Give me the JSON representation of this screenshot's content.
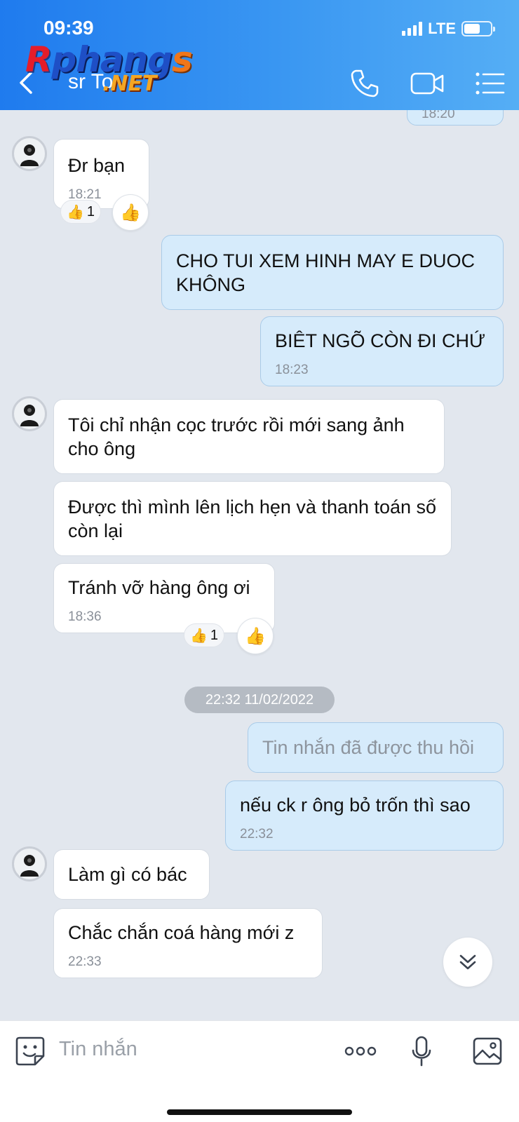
{
  "status_bar": {
    "time": "09:39",
    "network": "LTE"
  },
  "header": {
    "title": "sr To",
    "back_icon": "chevron-left-icon",
    "call_icon": "phone-icon",
    "video_icon": "video-camera-icon",
    "menu_icon": "list-menu-icon"
  },
  "watermark": {
    "brand": "Rphangs",
    "suffix": ".NET"
  },
  "messages": [
    {
      "time": "18:20"
    },
    {
      "text": "Đr bạn",
      "time": "18:21",
      "reaction_count": "1"
    },
    {
      "text": "CHO TUI XEM HINH MAY E DUOC KHÔNG"
    },
    {
      "text": "BIÊT NGÕ CÒN ĐI CHỨ",
      "time": "18:23"
    },
    {
      "text": "Tôi chỉ nhận cọc trước rồi mới sang ảnh cho ông"
    },
    {
      "text": "Được thì mình lên lịch hẹn và thanh toán số còn lại"
    },
    {
      "text": "Tránh vỡ hàng ông ơi",
      "time": "18:36",
      "reaction_count": "1"
    },
    {
      "text": "Tin nhắn đã được thu hồi"
    },
    {
      "text": "nếu ck r ông bỏ trốn thì sao",
      "time": "22:32"
    },
    {
      "text": "Làm gì có bác"
    },
    {
      "text": "Chắc chắn coá hàng mới z",
      "time": "22:33"
    }
  ],
  "date_separator": "22:32 11/02/2022",
  "input": {
    "placeholder": "Tin nhắn"
  },
  "colors": {
    "header_start": "#1f7bee",
    "header_end": "#55aef5",
    "outgoing_bubble": "#d6ebfb",
    "incoming_bubble": "#ffffff",
    "chat_bg": "#e2e7ee"
  }
}
